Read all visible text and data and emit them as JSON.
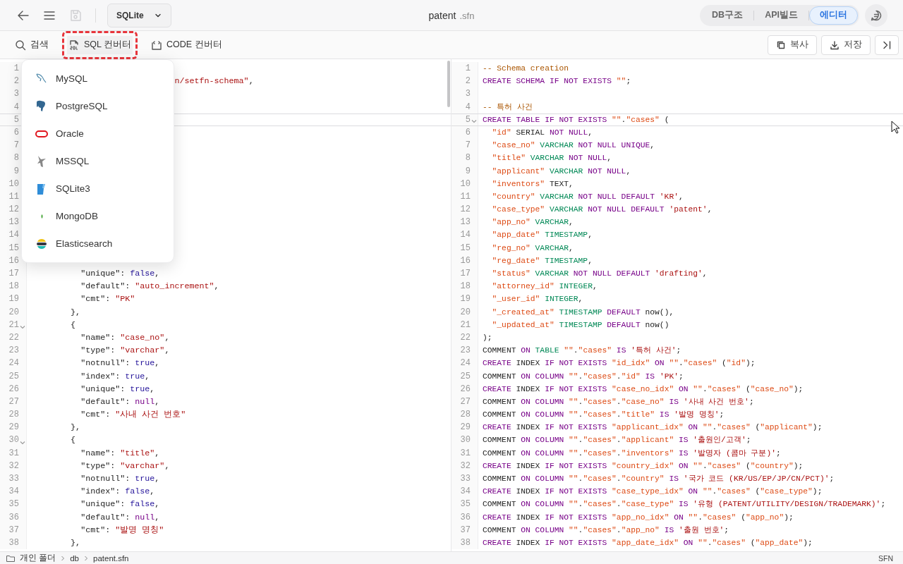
{
  "header": {
    "save_enabled": false,
    "db_select": {
      "value": "SQLite"
    },
    "title": {
      "name": "patent",
      "extension": ".sfn"
    }
  },
  "view_tabs": [
    {
      "label": "DB구조",
      "selected": false
    },
    {
      "label": "API빌드",
      "selected": false
    },
    {
      "label": "에디터",
      "selected": true
    }
  ],
  "toolbar": {
    "tools": [
      {
        "label": "검색",
        "selected": false,
        "highlighted": false
      },
      {
        "label": "SQL 컨버터",
        "selected": true,
        "highlighted": true
      },
      {
        "label": "CODE 컨버터",
        "selected": false,
        "highlighted": false
      }
    ],
    "actions": [
      {
        "label": "복사"
      },
      {
        "label": "저장"
      }
    ]
  },
  "converter_menu": {
    "items": [
      {
        "label": "MySQL"
      },
      {
        "label": "PostgreSQL"
      },
      {
        "label": "Oracle"
      },
      {
        "label": "MSSQL"
      },
      {
        "label": "SQLite3"
      },
      {
        "label": "MongoDB"
      },
      {
        "label": "Elasticsearch"
      }
    ]
  },
  "left_editor": {
    "lines": [
      {
        "number": "1",
        "active": false
      },
      {
        "number": "2",
        "active": false,
        "tokens": [
          {
            "kind": "str",
            "text": "                             n/setfn-schema\""
          },
          {
            "kind": "plain",
            "text": ","
          }
        ]
      },
      {
        "number": "3",
        "active": false
      },
      {
        "number": "4",
        "active": false
      },
      {
        "number": "5",
        "active": true
      },
      {
        "number": "6",
        "active": false
      },
      {
        "number": "7",
        "active": false
      },
      {
        "number": "8",
        "active": false
      },
      {
        "number": "9",
        "active": false
      },
      {
        "number": "10",
        "active": false
      },
      {
        "number": "11",
        "active": false
      },
      {
        "number": "12",
        "active": false
      },
      {
        "number": "13",
        "active": false
      },
      {
        "number": "14",
        "active": false
      },
      {
        "number": "15",
        "active": false
      },
      {
        "number": "16",
        "active": false
      },
      {
        "number": "17",
        "active": false,
        "foldable": false,
        "tokens": [
          {
            "kind": "plain",
            "text": "          \"unique\": "
          },
          {
            "kind": "bool",
            "text": "false"
          },
          {
            "kind": "plain",
            "text": ","
          }
        ]
      },
      {
        "number": "18",
        "active": false,
        "foldable": false,
        "tokens": [
          {
            "kind": "plain",
            "text": "          \"default\": "
          },
          {
            "kind": "str",
            "text": "\"auto_increment\""
          },
          {
            "kind": "plain",
            "text": ","
          }
        ]
      },
      {
        "number": "19",
        "active": false,
        "foldable": false,
        "tokens": [
          {
            "kind": "plain",
            "text": "          \"cmt\": "
          },
          {
            "kind": "str",
            "text": "\"PK\""
          }
        ]
      },
      {
        "number": "20",
        "active": false,
        "foldable": false,
        "tokens": [
          {
            "kind": "plain",
            "text": "        },"
          }
        ]
      },
      {
        "number": "21",
        "active": false,
        "foldable": true,
        "tokens": [
          {
            "kind": "plain",
            "text": "        {"
          }
        ]
      },
      {
        "number": "22",
        "active": false,
        "foldable": false,
        "tokens": [
          {
            "kind": "plain",
            "text": "          \"name\": "
          },
          {
            "kind": "str",
            "text": "\"case_no\""
          },
          {
            "kind": "plain",
            "text": ","
          }
        ]
      },
      {
        "number": "23",
        "active": false,
        "foldable": false,
        "tokens": [
          {
            "kind": "plain",
            "text": "          \"type\": "
          },
          {
            "kind": "str",
            "text": "\"varchar\""
          },
          {
            "kind": "plain",
            "text": ","
          }
        ]
      },
      {
        "number": "24",
        "active": false,
        "foldable": false,
        "tokens": [
          {
            "kind": "plain",
            "text": "          \"notnull\": "
          },
          {
            "kind": "bool",
            "text": "true"
          },
          {
            "kind": "plain",
            "text": ","
          }
        ]
      },
      {
        "number": "25",
        "active": false,
        "foldable": false,
        "tokens": [
          {
            "kind": "plain",
            "text": "          \"index\": "
          },
          {
            "kind": "bool",
            "text": "true"
          },
          {
            "kind": "plain",
            "text": ","
          }
        ]
      },
      {
        "number": "26",
        "active": false,
        "foldable": false,
        "tokens": [
          {
            "kind": "plain",
            "text": "          \"unique\": "
          },
          {
            "kind": "bool",
            "text": "true"
          },
          {
            "kind": "plain",
            "text": ","
          }
        ]
      },
      {
        "number": "27",
        "active": false,
        "foldable": false,
        "tokens": [
          {
            "kind": "plain",
            "text": "          \"default\": "
          },
          {
            "kind": "null",
            "text": "null"
          },
          {
            "kind": "plain",
            "text": ","
          }
        ]
      },
      {
        "number": "28",
        "active": false,
        "foldable": false,
        "tokens": [
          {
            "kind": "plain",
            "text": "          \"cmt\": "
          },
          {
            "kind": "str",
            "text": "\"사내 사건 번호\""
          }
        ]
      },
      {
        "number": "29",
        "active": false,
        "foldable": false,
        "tokens": [
          {
            "kind": "plain",
            "text": "        },"
          }
        ]
      },
      {
        "number": "30",
        "active": false,
        "foldable": true,
        "tokens": [
          {
            "kind": "plain",
            "text": "        {"
          }
        ]
      },
      {
        "number": "31",
        "active": false,
        "foldable": false,
        "tokens": [
          {
            "kind": "plain",
            "text": "          \"name\": "
          },
          {
            "kind": "str",
            "text": "\"title\""
          },
          {
            "kind": "plain",
            "text": ","
          }
        ]
      },
      {
        "number": "32",
        "active": false,
        "foldable": false,
        "tokens": [
          {
            "kind": "plain",
            "text": "          \"type\": "
          },
          {
            "kind": "str",
            "text": "\"varchar\""
          },
          {
            "kind": "plain",
            "text": ","
          }
        ]
      },
      {
        "number": "33",
        "active": false,
        "foldable": false,
        "tokens": [
          {
            "kind": "plain",
            "text": "          \"notnull\": "
          },
          {
            "kind": "bool",
            "text": "true"
          },
          {
            "kind": "plain",
            "text": ","
          }
        ]
      },
      {
        "number": "34",
        "active": false,
        "foldable": false,
        "tokens": [
          {
            "kind": "plain",
            "text": "          \"index\": "
          },
          {
            "kind": "bool",
            "text": "false"
          },
          {
            "kind": "plain",
            "text": ","
          }
        ]
      },
      {
        "number": "35",
        "active": false,
        "foldable": false,
        "tokens": [
          {
            "kind": "plain",
            "text": "          \"unique\": "
          },
          {
            "kind": "bool",
            "text": "false"
          },
          {
            "kind": "plain",
            "text": ","
          }
        ]
      },
      {
        "number": "36",
        "active": false,
        "foldable": false,
        "tokens": [
          {
            "kind": "plain",
            "text": "          \"default\": "
          },
          {
            "kind": "null",
            "text": "null"
          },
          {
            "kind": "plain",
            "text": ","
          }
        ]
      },
      {
        "number": "37",
        "active": false,
        "foldable": false,
        "tokens": [
          {
            "kind": "plain",
            "text": "          \"cmt\": "
          },
          {
            "kind": "str",
            "text": "\"발명 명칭\""
          }
        ]
      },
      {
        "number": "38",
        "active": false,
        "foldable": false,
        "tokens": [
          {
            "kind": "plain",
            "text": "        },"
          }
        ]
      }
    ]
  },
  "right_editor": {
    "lines": [
      {
        "number": "1",
        "active": false,
        "foldable": false,
        "tokens": [
          {
            "kind": "cmt",
            "text": "-- Schema creation"
          }
        ]
      },
      {
        "number": "2",
        "active": false,
        "foldable": false,
        "tokens": [
          {
            "kind": "kw",
            "text": "CREATE SCHEMA IF NOT EXISTS "
          },
          {
            "kind": "ident",
            "text": "\"\""
          },
          {
            "kind": "plain",
            "text": ";"
          }
        ]
      },
      {
        "number": "3",
        "active": false,
        "foldable": false
      },
      {
        "number": "4",
        "active": false,
        "foldable": false,
        "tokens": [
          {
            "kind": "cmt",
            "text": "-- 특허 사건"
          }
        ]
      },
      {
        "number": "5",
        "active": true,
        "foldable": true,
        "tokens": [
          {
            "kind": "kw",
            "text": "CREATE TABLE IF NOT EXISTS "
          },
          {
            "kind": "ident",
            "text": "\"\""
          },
          {
            "kind": "plain",
            "text": "."
          },
          {
            "kind": "ident",
            "text": "\"cases\""
          },
          {
            "kind": "plain",
            "text": " ("
          }
        ]
      },
      {
        "number": "6",
        "active": false,
        "foldable": false,
        "tokens": [
          {
            "kind": "ident",
            "text": "  \"id\""
          },
          {
            "kind": "plain",
            "text": " SERIAL "
          },
          {
            "kind": "kw",
            "text": "NOT NULL"
          },
          {
            "kind": "plain",
            "text": ","
          }
        ]
      },
      {
        "number": "7",
        "active": false,
        "foldable": false,
        "tokens": [
          {
            "kind": "ident",
            "text": "  \"case_no\""
          },
          {
            "kind": "type",
            "text": " VARCHAR "
          },
          {
            "kind": "kw",
            "text": "NOT NULL UNIQUE"
          },
          {
            "kind": "plain",
            "text": ","
          }
        ]
      },
      {
        "number": "8",
        "active": false,
        "foldable": false,
        "tokens": [
          {
            "kind": "ident",
            "text": "  \"title\""
          },
          {
            "kind": "type",
            "text": " VARCHAR "
          },
          {
            "kind": "kw",
            "text": "NOT NULL"
          },
          {
            "kind": "plain",
            "text": ","
          }
        ]
      },
      {
        "number": "9",
        "active": false,
        "foldable": false,
        "tokens": [
          {
            "kind": "ident",
            "text": "  \"applicant\""
          },
          {
            "kind": "type",
            "text": " VARCHAR "
          },
          {
            "kind": "kw",
            "text": "NOT NULL"
          },
          {
            "kind": "plain",
            "text": ","
          }
        ]
      },
      {
        "number": "10",
        "active": false,
        "foldable": false,
        "tokens": [
          {
            "kind": "ident",
            "text": "  \"inventors\""
          },
          {
            "kind": "plain",
            "text": " TEXT,"
          }
        ]
      },
      {
        "number": "11",
        "active": false,
        "foldable": false,
        "tokens": [
          {
            "kind": "ident",
            "text": "  \"country\""
          },
          {
            "kind": "type",
            "text": " VARCHAR "
          },
          {
            "kind": "kw",
            "text": "NOT NULL DEFAULT "
          },
          {
            "kind": "str",
            "text": "'KR'"
          },
          {
            "kind": "plain",
            "text": ","
          }
        ]
      },
      {
        "number": "12",
        "active": false,
        "foldable": false,
        "tokens": [
          {
            "kind": "ident",
            "text": "  \"case_type\""
          },
          {
            "kind": "type",
            "text": " VARCHAR "
          },
          {
            "kind": "kw",
            "text": "NOT NULL DEFAULT "
          },
          {
            "kind": "str",
            "text": "'patent'"
          },
          {
            "kind": "plain",
            "text": ","
          }
        ]
      },
      {
        "number": "13",
        "active": false,
        "foldable": false,
        "tokens": [
          {
            "kind": "ident",
            "text": "  \"app_no\""
          },
          {
            "kind": "type",
            "text": " VARCHAR"
          },
          {
            "kind": "plain",
            "text": ","
          }
        ]
      },
      {
        "number": "14",
        "active": false,
        "foldable": false,
        "tokens": [
          {
            "kind": "ident",
            "text": "  \"app_date\""
          },
          {
            "kind": "type",
            "text": " TIMESTAMP"
          },
          {
            "kind": "plain",
            "text": ","
          }
        ]
      },
      {
        "number": "15",
        "active": false,
        "foldable": false,
        "tokens": [
          {
            "kind": "ident",
            "text": "  \"reg_no\""
          },
          {
            "kind": "type",
            "text": " VARCHAR"
          },
          {
            "kind": "plain",
            "text": ","
          }
        ]
      },
      {
        "number": "16",
        "active": false,
        "foldable": false,
        "tokens": [
          {
            "kind": "ident",
            "text": "  \"reg_date\""
          },
          {
            "kind": "type",
            "text": " TIMESTAMP"
          },
          {
            "kind": "plain",
            "text": ","
          }
        ]
      },
      {
        "number": "17",
        "active": false,
        "foldable": false,
        "tokens": [
          {
            "kind": "ident",
            "text": "  \"status\""
          },
          {
            "kind": "type",
            "text": " VARCHAR "
          },
          {
            "kind": "kw",
            "text": "NOT NULL DEFAULT "
          },
          {
            "kind": "str",
            "text": "'drafting'"
          },
          {
            "kind": "plain",
            "text": ","
          }
        ]
      },
      {
        "number": "18",
        "active": false,
        "foldable": false,
        "tokens": [
          {
            "kind": "ident",
            "text": "  \"attorney_id\""
          },
          {
            "kind": "type",
            "text": " INTEGER"
          },
          {
            "kind": "plain",
            "text": ","
          }
        ]
      },
      {
        "number": "19",
        "active": false,
        "foldable": false,
        "tokens": [
          {
            "kind": "ident",
            "text": "  \"_user_id\""
          },
          {
            "kind": "type",
            "text": " INTEGER"
          },
          {
            "kind": "plain",
            "text": ","
          }
        ]
      },
      {
        "number": "20",
        "active": false,
        "foldable": false,
        "tokens": [
          {
            "kind": "ident",
            "text": "  \"_created_at\""
          },
          {
            "kind": "type",
            "text": " TIMESTAMP "
          },
          {
            "kind": "kw",
            "text": "DEFAULT"
          },
          {
            "kind": "plain",
            "text": " now(),"
          }
        ]
      },
      {
        "number": "21",
        "active": false,
        "foldable": false,
        "tokens": [
          {
            "kind": "ident",
            "text": "  \"_updated_at\""
          },
          {
            "kind": "type",
            "text": " TIMESTAMP "
          },
          {
            "kind": "kw",
            "text": "DEFAULT"
          },
          {
            "kind": "plain",
            "text": " now()"
          }
        ]
      },
      {
        "number": "22",
        "active": false,
        "foldable": false,
        "tokens": [
          {
            "kind": "plain",
            "text": ");"
          }
        ]
      },
      {
        "number": "23",
        "active": false,
        "foldable": false,
        "tokens": [
          {
            "kind": "plain",
            "text": "COMMENT "
          },
          {
            "kind": "kw",
            "text": "ON "
          },
          {
            "kind": "type",
            "text": "TABLE "
          },
          {
            "kind": "ident",
            "text": "\"\""
          },
          {
            "kind": "plain",
            "text": "."
          },
          {
            "kind": "ident",
            "text": "\"cases\""
          },
          {
            "kind": "kw",
            "text": " IS "
          },
          {
            "kind": "str",
            "text": "'특허 사건'"
          },
          {
            "kind": "plain",
            "text": ";"
          }
        ]
      },
      {
        "number": "24",
        "active": false,
        "foldable": false,
        "tokens": [
          {
            "kind": "kw",
            "text": "CREATE"
          },
          {
            "kind": "plain",
            "text": " INDEX "
          },
          {
            "kind": "kw",
            "text": "IF NOT EXISTS "
          },
          {
            "kind": "ident",
            "text": "\"id_idx\""
          },
          {
            "kind": "kw",
            "text": " ON "
          },
          {
            "kind": "ident",
            "text": "\"\""
          },
          {
            "kind": "plain",
            "text": "."
          },
          {
            "kind": "ident",
            "text": "\"cases\""
          },
          {
            "kind": "plain",
            "text": " ("
          },
          {
            "kind": "ident",
            "text": "\"id\""
          },
          {
            "kind": "plain",
            "text": ");"
          }
        ]
      },
      {
        "number": "25",
        "active": false,
        "foldable": false,
        "tokens": [
          {
            "kind": "plain",
            "text": "COMMENT "
          },
          {
            "kind": "kw",
            "text": "ON COLUMN "
          },
          {
            "kind": "ident",
            "text": "\"\""
          },
          {
            "kind": "plain",
            "text": "."
          },
          {
            "kind": "ident",
            "text": "\"cases\""
          },
          {
            "kind": "plain",
            "text": "."
          },
          {
            "kind": "ident",
            "text": "\"id\""
          },
          {
            "kind": "kw",
            "text": " IS "
          },
          {
            "kind": "str",
            "text": "'PK'"
          },
          {
            "kind": "plain",
            "text": ";"
          }
        ]
      },
      {
        "number": "26",
        "active": false,
        "foldable": false,
        "tokens": [
          {
            "kind": "kw",
            "text": "CREATE"
          },
          {
            "kind": "plain",
            "text": " INDEX "
          },
          {
            "kind": "kw",
            "text": "IF NOT EXISTS "
          },
          {
            "kind": "ident",
            "text": "\"case_no_idx\""
          },
          {
            "kind": "kw",
            "text": " ON "
          },
          {
            "kind": "ident",
            "text": "\"\""
          },
          {
            "kind": "plain",
            "text": "."
          },
          {
            "kind": "ident",
            "text": "\"cases\""
          },
          {
            "kind": "plain",
            "text": " ("
          },
          {
            "kind": "ident",
            "text": "\"case_no\""
          },
          {
            "kind": "plain",
            "text": ");"
          }
        ]
      },
      {
        "number": "27",
        "active": false,
        "foldable": false,
        "tokens": [
          {
            "kind": "plain",
            "text": "COMMENT "
          },
          {
            "kind": "kw",
            "text": "ON COLUMN "
          },
          {
            "kind": "ident",
            "text": "\"\""
          },
          {
            "kind": "plain",
            "text": "."
          },
          {
            "kind": "ident",
            "text": "\"cases\""
          },
          {
            "kind": "plain",
            "text": "."
          },
          {
            "kind": "ident",
            "text": "\"case_no\""
          },
          {
            "kind": "kw",
            "text": " IS "
          },
          {
            "kind": "str",
            "text": "'사내 사건 번호'"
          },
          {
            "kind": "plain",
            "text": ";"
          }
        ]
      },
      {
        "number": "28",
        "active": false,
        "foldable": false,
        "tokens": [
          {
            "kind": "plain",
            "text": "COMMENT "
          },
          {
            "kind": "kw",
            "text": "ON COLUMN "
          },
          {
            "kind": "ident",
            "text": "\"\""
          },
          {
            "kind": "plain",
            "text": "."
          },
          {
            "kind": "ident",
            "text": "\"cases\""
          },
          {
            "kind": "plain",
            "text": "."
          },
          {
            "kind": "ident",
            "text": "\"title\""
          },
          {
            "kind": "kw",
            "text": " IS "
          },
          {
            "kind": "str",
            "text": "'발명 명칭'"
          },
          {
            "kind": "plain",
            "text": ";"
          }
        ]
      },
      {
        "number": "29",
        "active": false,
        "foldable": false,
        "tokens": [
          {
            "kind": "kw",
            "text": "CREATE"
          },
          {
            "kind": "plain",
            "text": " INDEX "
          },
          {
            "kind": "kw",
            "text": "IF NOT EXISTS "
          },
          {
            "kind": "ident",
            "text": "\"applicant_idx\""
          },
          {
            "kind": "kw",
            "text": " ON "
          },
          {
            "kind": "ident",
            "text": "\"\""
          },
          {
            "kind": "plain",
            "text": "."
          },
          {
            "kind": "ident",
            "text": "\"cases\""
          },
          {
            "kind": "plain",
            "text": " ("
          },
          {
            "kind": "ident",
            "text": "\"applicant\""
          },
          {
            "kind": "plain",
            "text": ");"
          }
        ]
      },
      {
        "number": "30",
        "active": false,
        "foldable": false,
        "tokens": [
          {
            "kind": "plain",
            "text": "COMMENT "
          },
          {
            "kind": "kw",
            "text": "ON COLUMN "
          },
          {
            "kind": "ident",
            "text": "\"\""
          },
          {
            "kind": "plain",
            "text": "."
          },
          {
            "kind": "ident",
            "text": "\"cases\""
          },
          {
            "kind": "plain",
            "text": "."
          },
          {
            "kind": "ident",
            "text": "\"applicant\""
          },
          {
            "kind": "kw",
            "text": " IS "
          },
          {
            "kind": "str",
            "text": "'출원인/고객'"
          },
          {
            "kind": "plain",
            "text": ";"
          }
        ]
      },
      {
        "number": "31",
        "active": false,
        "foldable": false,
        "tokens": [
          {
            "kind": "plain",
            "text": "COMMENT "
          },
          {
            "kind": "kw",
            "text": "ON COLUMN "
          },
          {
            "kind": "ident",
            "text": "\"\""
          },
          {
            "kind": "plain",
            "text": "."
          },
          {
            "kind": "ident",
            "text": "\"cases\""
          },
          {
            "kind": "plain",
            "text": "."
          },
          {
            "kind": "ident",
            "text": "\"inventors\""
          },
          {
            "kind": "kw",
            "text": " IS "
          },
          {
            "kind": "str",
            "text": "'발명자 (콤마 구분)'"
          },
          {
            "kind": "plain",
            "text": ";"
          }
        ]
      },
      {
        "number": "32",
        "active": false,
        "foldable": false,
        "tokens": [
          {
            "kind": "kw",
            "text": "CREATE"
          },
          {
            "kind": "plain",
            "text": " INDEX "
          },
          {
            "kind": "kw",
            "text": "IF NOT EXISTS "
          },
          {
            "kind": "ident",
            "text": "\"country_idx\""
          },
          {
            "kind": "kw",
            "text": " ON "
          },
          {
            "kind": "ident",
            "text": "\"\""
          },
          {
            "kind": "plain",
            "text": "."
          },
          {
            "kind": "ident",
            "text": "\"cases\""
          },
          {
            "kind": "plain",
            "text": " ("
          },
          {
            "kind": "ident",
            "text": "\"country\""
          },
          {
            "kind": "plain",
            "text": ");"
          }
        ]
      },
      {
        "number": "33",
        "active": false,
        "foldable": false,
        "tokens": [
          {
            "kind": "plain",
            "text": "COMMENT "
          },
          {
            "kind": "kw",
            "text": "ON COLUMN "
          },
          {
            "kind": "ident",
            "text": "\"\""
          },
          {
            "kind": "plain",
            "text": "."
          },
          {
            "kind": "ident",
            "text": "\"cases\""
          },
          {
            "kind": "plain",
            "text": "."
          },
          {
            "kind": "ident",
            "text": "\"country\""
          },
          {
            "kind": "kw",
            "text": " IS "
          },
          {
            "kind": "str",
            "text": "'국가 코드 (KR/US/EP/JP/CN/PCT)'"
          },
          {
            "kind": "plain",
            "text": ";"
          }
        ]
      },
      {
        "number": "34",
        "active": false,
        "foldable": false,
        "tokens": [
          {
            "kind": "kw",
            "text": "CREATE"
          },
          {
            "kind": "plain",
            "text": " INDEX "
          },
          {
            "kind": "kw",
            "text": "IF NOT EXISTS "
          },
          {
            "kind": "ident",
            "text": "\"case_type_idx\""
          },
          {
            "kind": "kw",
            "text": " ON "
          },
          {
            "kind": "ident",
            "text": "\"\""
          },
          {
            "kind": "plain",
            "text": "."
          },
          {
            "kind": "ident",
            "text": "\"cases\""
          },
          {
            "kind": "plain",
            "text": " ("
          },
          {
            "kind": "ident",
            "text": "\"case_type\""
          },
          {
            "kind": "plain",
            "text": ");"
          }
        ]
      },
      {
        "number": "35",
        "active": false,
        "foldable": false,
        "tokens": [
          {
            "kind": "plain",
            "text": "COMMENT "
          },
          {
            "kind": "kw",
            "text": "ON COLUMN "
          },
          {
            "kind": "ident",
            "text": "\"\""
          },
          {
            "kind": "plain",
            "text": "."
          },
          {
            "kind": "ident",
            "text": "\"cases\""
          },
          {
            "kind": "plain",
            "text": "."
          },
          {
            "kind": "ident",
            "text": "\"case_type\""
          },
          {
            "kind": "kw",
            "text": " IS "
          },
          {
            "kind": "str",
            "text": "'유형 (PATENT/UTILITY/DESIGN/TRADEMARK)'"
          },
          {
            "kind": "plain",
            "text": ";"
          }
        ]
      },
      {
        "number": "36",
        "active": false,
        "foldable": false,
        "tokens": [
          {
            "kind": "kw",
            "text": "CREATE"
          },
          {
            "kind": "plain",
            "text": " INDEX "
          },
          {
            "kind": "kw",
            "text": "IF NOT EXISTS "
          },
          {
            "kind": "ident",
            "text": "\"app_no_idx\""
          },
          {
            "kind": "kw",
            "text": " ON "
          },
          {
            "kind": "ident",
            "text": "\"\""
          },
          {
            "kind": "plain",
            "text": "."
          },
          {
            "kind": "ident",
            "text": "\"cases\""
          },
          {
            "kind": "plain",
            "text": " ("
          },
          {
            "kind": "ident",
            "text": "\"app_no\""
          },
          {
            "kind": "plain",
            "text": ");"
          }
        ]
      },
      {
        "number": "37",
        "active": false,
        "foldable": false,
        "tokens": [
          {
            "kind": "plain",
            "text": "COMMENT "
          },
          {
            "kind": "kw",
            "text": "ON COLUMN "
          },
          {
            "kind": "ident",
            "text": "\"\""
          },
          {
            "kind": "plain",
            "text": "."
          },
          {
            "kind": "ident",
            "text": "\"cases\""
          },
          {
            "kind": "plain",
            "text": "."
          },
          {
            "kind": "ident",
            "text": "\"app_no\""
          },
          {
            "kind": "kw",
            "text": " IS "
          },
          {
            "kind": "str",
            "text": "'출원 번호'"
          },
          {
            "kind": "plain",
            "text": ";"
          }
        ]
      },
      {
        "number": "38",
        "active": false,
        "foldable": false,
        "tokens": [
          {
            "kind": "kw",
            "text": "CREATE"
          },
          {
            "kind": "plain",
            "text": " INDEX "
          },
          {
            "kind": "kw",
            "text": "IF NOT EXISTS "
          },
          {
            "kind": "ident",
            "text": "\"app_date_idx\""
          },
          {
            "kind": "kw",
            "text": " ON "
          },
          {
            "kind": "ident",
            "text": "\"\""
          },
          {
            "kind": "plain",
            "text": "."
          },
          {
            "kind": "ident",
            "text": "\"cases\""
          },
          {
            "kind": "plain",
            "text": " ("
          },
          {
            "kind": "ident",
            "text": "\"app_date\""
          },
          {
            "kind": "plain",
            "text": ");"
          }
        ]
      }
    ]
  },
  "status_bar": {
    "path": [
      "개인 폴더",
      "db",
      "patent.sfn"
    ],
    "format": "SFN"
  }
}
